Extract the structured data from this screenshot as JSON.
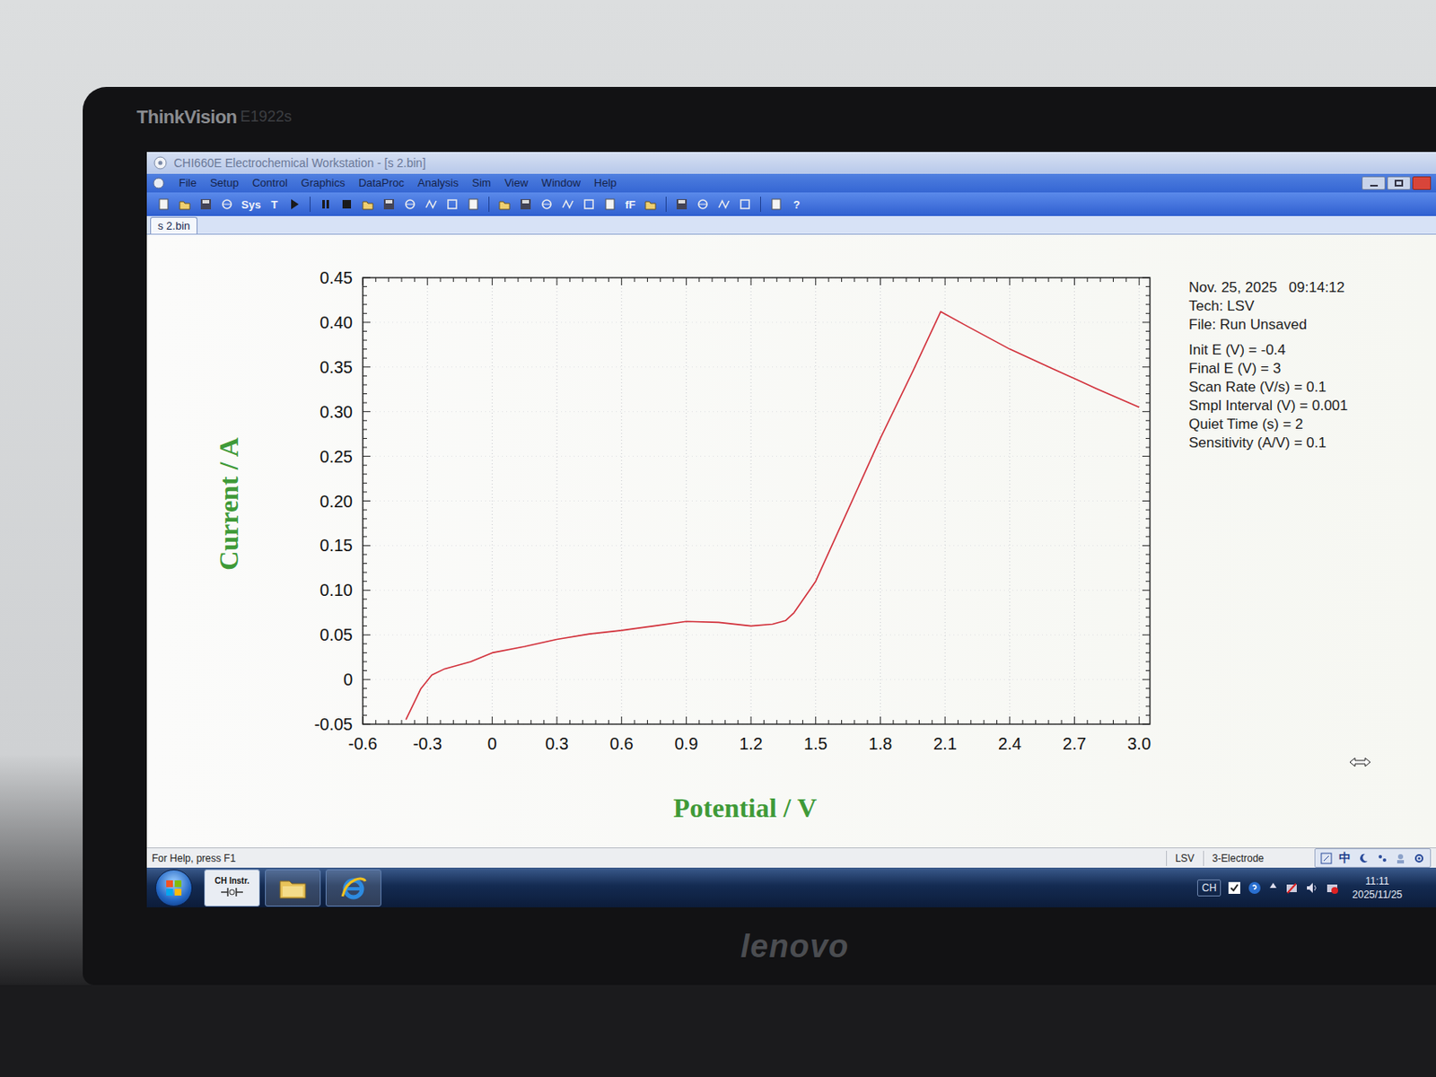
{
  "monitor": {
    "brand": "ThinkVision",
    "model": "E1922s",
    "maker": "lenovo"
  },
  "window": {
    "title": "CHI660E Electrochemical Workstation - [s 2.bin]"
  },
  "menu": [
    "File",
    "Setup",
    "Control",
    "Graphics",
    "DataProc",
    "Analysis",
    "Sim",
    "View",
    "Window",
    "Help"
  ],
  "toolbar": [
    {
      "kind": "icon"
    },
    {
      "kind": "icon"
    },
    {
      "kind": "icon"
    },
    {
      "kind": "icon"
    },
    {
      "kind": "label",
      "label": "Sys"
    },
    {
      "kind": "label",
      "label": "T"
    },
    {
      "kind": "icon"
    },
    {
      "kind": "sep"
    },
    {
      "kind": "icon"
    },
    {
      "kind": "icon"
    },
    {
      "kind": "icon"
    },
    {
      "kind": "icon"
    },
    {
      "kind": "icon"
    },
    {
      "kind": "icon"
    },
    {
      "kind": "icon"
    },
    {
      "kind": "icon"
    },
    {
      "kind": "sep"
    },
    {
      "kind": "icon"
    },
    {
      "kind": "icon"
    },
    {
      "kind": "icon"
    },
    {
      "kind": "icon"
    },
    {
      "kind": "icon"
    },
    {
      "kind": "icon"
    },
    {
      "kind": "label",
      "label": "fF"
    },
    {
      "kind": "icon"
    },
    {
      "kind": "sep"
    },
    {
      "kind": "icon"
    },
    {
      "kind": "icon"
    },
    {
      "kind": "icon"
    },
    {
      "kind": "icon"
    },
    {
      "kind": "sep"
    },
    {
      "kind": "icon"
    },
    {
      "kind": "label",
      "label": "?"
    }
  ],
  "tabs": [
    {
      "label": "s 2.bin",
      "selected": true
    }
  ],
  "chart": {
    "x_title": "Potential / V",
    "y_title": "Current / A",
    "x_ticks": [
      {
        "label": "-0.6",
        "value": -0.6
      },
      {
        "label": "-0.3",
        "value": -0.3
      },
      {
        "label": "0",
        "value": 0
      },
      {
        "label": "0.3",
        "value": 0.3
      },
      {
        "label": "0.6",
        "value": 0.6
      },
      {
        "label": "0.9",
        "value": 0.9
      },
      {
        "label": "1.2",
        "value": 1.2
      },
      {
        "label": "1.5",
        "value": 1.5
      },
      {
        "label": "1.8",
        "value": 1.8
      },
      {
        "label": "2.1",
        "value": 2.1
      },
      {
        "label": "2.4",
        "value": 2.4
      },
      {
        "label": "2.7",
        "value": 2.7
      },
      {
        "label": "3.0",
        "value": 3.0
      }
    ],
    "y_ticks": [
      {
        "label": "0.45",
        "value": 0.45
      },
      {
        "label": "0.40",
        "value": 0.4
      },
      {
        "label": "0.35",
        "value": 0.35
      },
      {
        "label": "0.30",
        "value": 0.3
      },
      {
        "label": "0.25",
        "value": 0.25
      },
      {
        "label": "0.20",
        "value": 0.2
      },
      {
        "label": "0.15",
        "value": 0.15
      },
      {
        "label": "0.10",
        "value": 0.1
      },
      {
        "label": "0.05",
        "value": 0.05
      },
      {
        "label": "0",
        "value": 0
      },
      {
        "label": "-0.05",
        "value": -0.05
      }
    ],
    "series": [
      {
        "points": [
          [
            -0.4,
            -0.045
          ],
          [
            -0.33,
            -0.01
          ],
          [
            -0.28,
            0.005
          ],
          [
            -0.22,
            0.012
          ],
          [
            -0.1,
            0.02
          ],
          [
            0.0,
            0.03
          ],
          [
            0.15,
            0.037
          ],
          [
            0.3,
            0.045
          ],
          [
            0.45,
            0.051
          ],
          [
            0.6,
            0.055
          ],
          [
            0.75,
            0.06
          ],
          [
            0.9,
            0.065
          ],
          [
            1.05,
            0.064
          ],
          [
            1.2,
            0.06
          ],
          [
            1.3,
            0.062
          ],
          [
            1.36,
            0.066
          ],
          [
            1.4,
            0.075
          ],
          [
            1.5,
            0.11
          ],
          [
            1.65,
            0.19
          ],
          [
            1.8,
            0.27
          ],
          [
            1.95,
            0.345
          ],
          [
            2.08,
            0.412
          ],
          [
            2.2,
            0.396
          ],
          [
            2.4,
            0.37
          ],
          [
            2.6,
            0.348
          ],
          [
            2.8,
            0.326
          ],
          [
            3.0,
            0.305
          ]
        ]
      }
    ]
  },
  "info": {
    "date": "Nov. 25, 2025",
    "time": "09:14:12",
    "lines": [
      "Tech: LSV",
      "File: Run Unsaved"
    ],
    "params": [
      "Init E (V) = -0.4",
      "Final E (V) = 3",
      "Scan Rate (V/s) = 0.1",
      "Smpl Interval (V) = 0.001",
      "Quiet Time (s) = 2",
      "Sensitivity (A/V) = 0.1"
    ]
  },
  "status_bar": {
    "help": "For Help, press F1",
    "mode": "LSV",
    "electrode": "3-Electrode",
    "ime": "中"
  },
  "taskbar": {
    "apps": [
      {
        "kind": "ch",
        "label": "CH Instr."
      },
      {
        "kind": "folder"
      },
      {
        "kind": "ie"
      }
    ],
    "tray": {
      "lang": "CH",
      "time": "11:11",
      "date": "2025/11/25"
    }
  }
}
